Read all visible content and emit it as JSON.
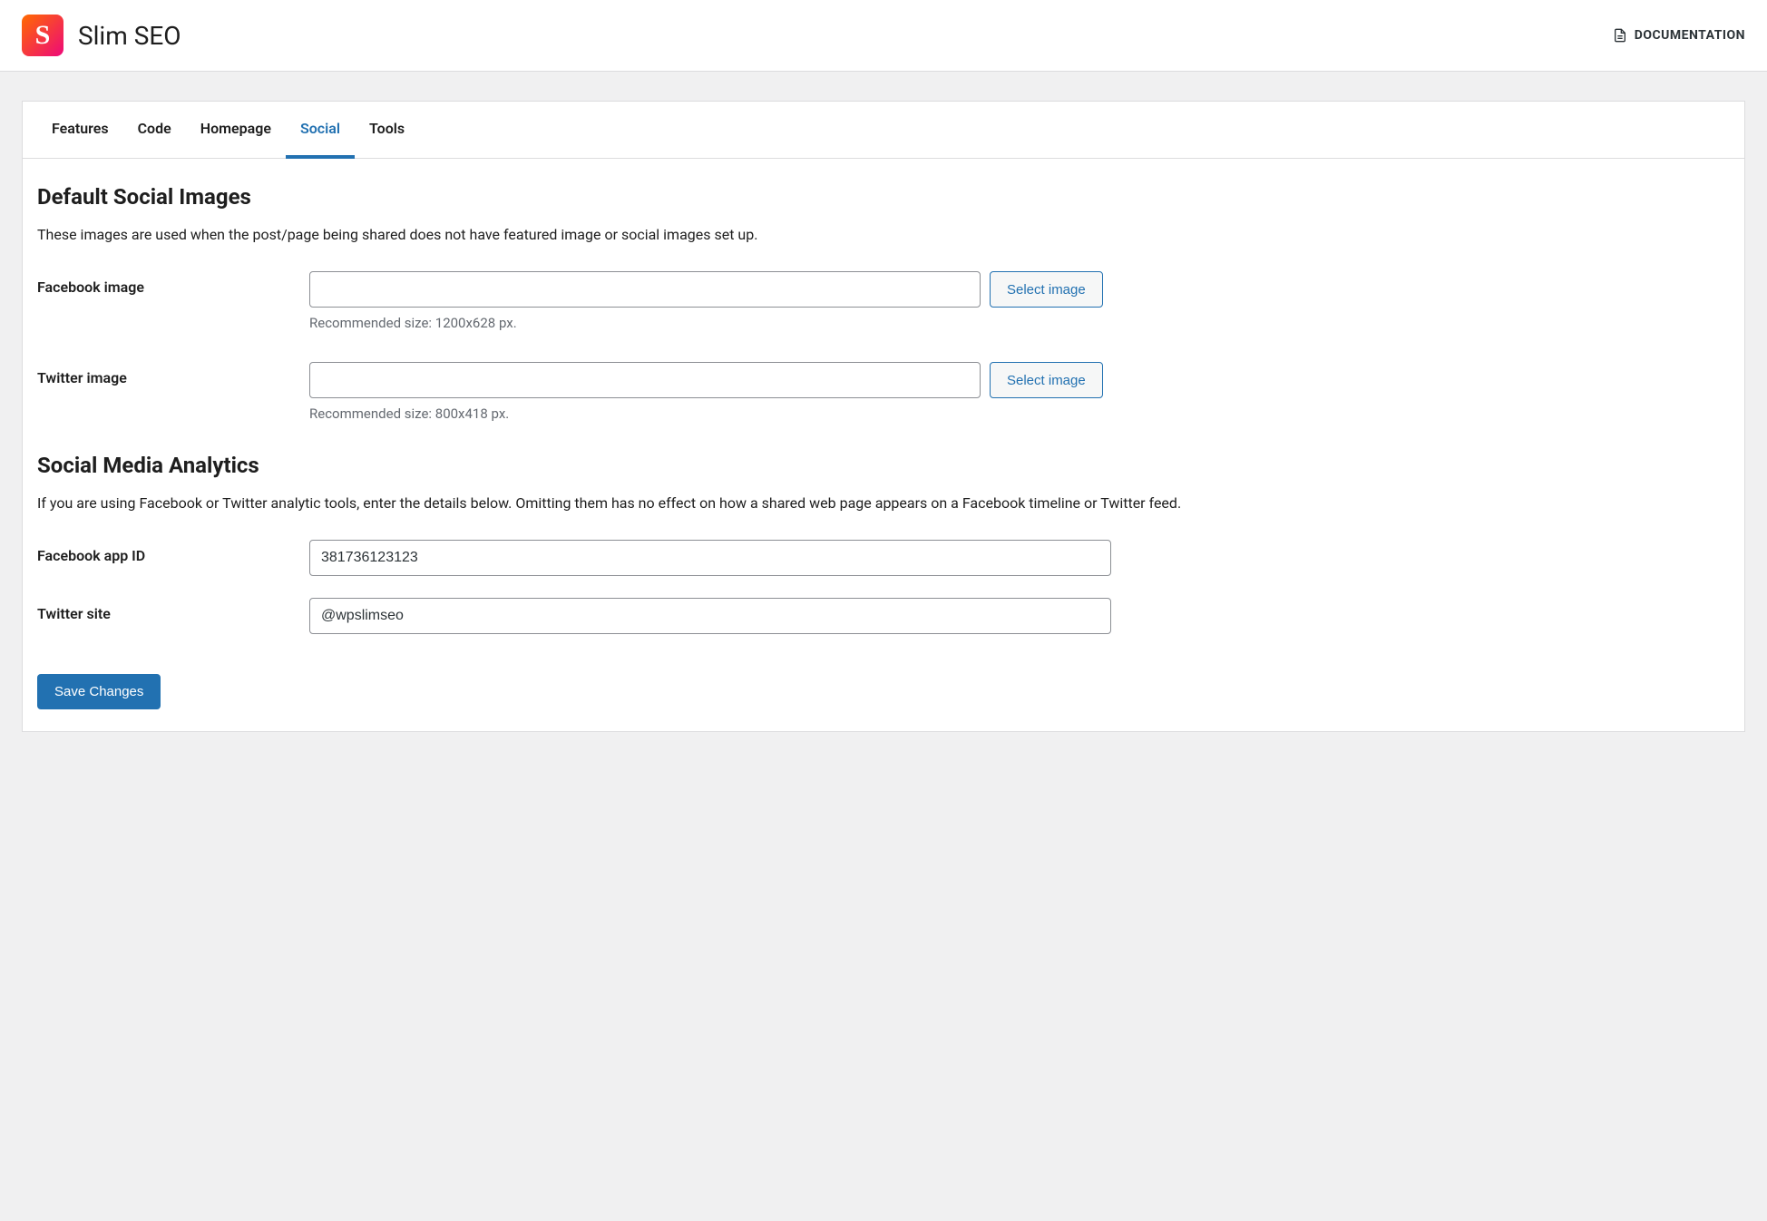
{
  "header": {
    "app_title": "Slim SEO",
    "logo_letter": "S",
    "doc_link_label": "DOCUMENTATION"
  },
  "tabs": {
    "features": "Features",
    "code": "Code",
    "homepage": "Homepage",
    "social": "Social",
    "tools": "Tools"
  },
  "sections": {
    "default_images": {
      "heading": "Default Social Images",
      "desc": "These images are used when the post/page being shared does not have featured image or social images set up."
    },
    "analytics": {
      "heading": "Social Media Analytics",
      "desc": "If you are using Facebook or Twitter analytic tools, enter the details below. Omitting them has no effect on how a shared web page appears on a Facebook timeline or Twitter feed."
    }
  },
  "fields": {
    "facebook_image": {
      "label": "Facebook image",
      "value": "",
      "button": "Select image",
      "hint": "Recommended size: 1200x628 px."
    },
    "twitter_image": {
      "label": "Twitter image",
      "value": "",
      "button": "Select image",
      "hint": "Recommended size: 800x418 px."
    },
    "facebook_app_id": {
      "label": "Facebook app ID",
      "value": "381736123123"
    },
    "twitter_site": {
      "label": "Twitter site",
      "value": "@wpslimseo"
    }
  },
  "buttons": {
    "save": "Save Changes"
  }
}
